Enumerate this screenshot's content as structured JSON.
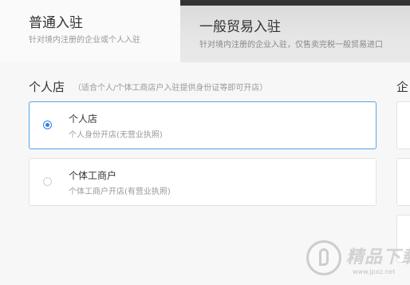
{
  "tabs": {
    "regular": {
      "title": "普通入驻",
      "subtitle": "针对境内注册的企业或个人入驻"
    },
    "general_trade": {
      "title": "一般贸易入驻",
      "subtitle": "针对境内注册的企业入驻，仅售卖完税一般贸易进口"
    }
  },
  "personal_section": {
    "title": "个人店",
    "hint": "（适合个人/个体工商店户入驻提供身份证等即可开店）",
    "options": [
      {
        "title": "个人店",
        "subtitle": "个人身份开店(无营业执照)",
        "selected": true
      },
      {
        "title": "个体工商户",
        "subtitle": "个体工商户开店(有营业执照)",
        "selected": false
      }
    ]
  },
  "enterprise_section": {
    "title_fragment": "企"
  },
  "watermark": {
    "text": "精品下载",
    "url": "www.jpxz.net"
  },
  "colors": {
    "accent": "#2f7fe0",
    "selected_border": "#57a3e5"
  }
}
